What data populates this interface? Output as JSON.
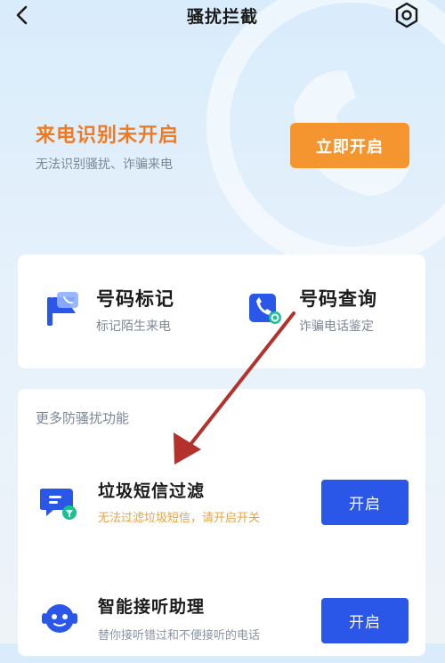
{
  "header": {
    "title": "骚扰拦截",
    "back_icon": "back-chevron-icon",
    "settings_icon": "gear-icon"
  },
  "banner": {
    "title": "来电识别未开启",
    "subtitle": "无法识别骚扰、诈骗来电",
    "button_label": "立即开启",
    "title_color": "#f07a22",
    "button_color": "#f4952f"
  },
  "tools": [
    {
      "name": "号码标记",
      "desc": "标记陌生来电",
      "icon": "number-mark-icon"
    },
    {
      "name": "号码查询",
      "desc": "诈骗电话鉴定",
      "icon": "number-query-icon"
    }
  ],
  "more": {
    "section_title": "更多防骚扰功能",
    "items": [
      {
        "name": "垃圾短信过滤",
        "desc": "无法过滤垃圾短信，请开启开关",
        "desc_color": "#e8a33d",
        "button_label": "开启",
        "icon": "sms-filter-icon"
      },
      {
        "name": "智能接听助理",
        "desc": "替你接听错过和不便接听的电话",
        "desc_color": "#8a94a3",
        "button_label": "开启",
        "icon": "robot-assistant-icon"
      }
    ]
  },
  "accent_color": "#2b57e8",
  "annotation_arrow_color": "#b3322c"
}
